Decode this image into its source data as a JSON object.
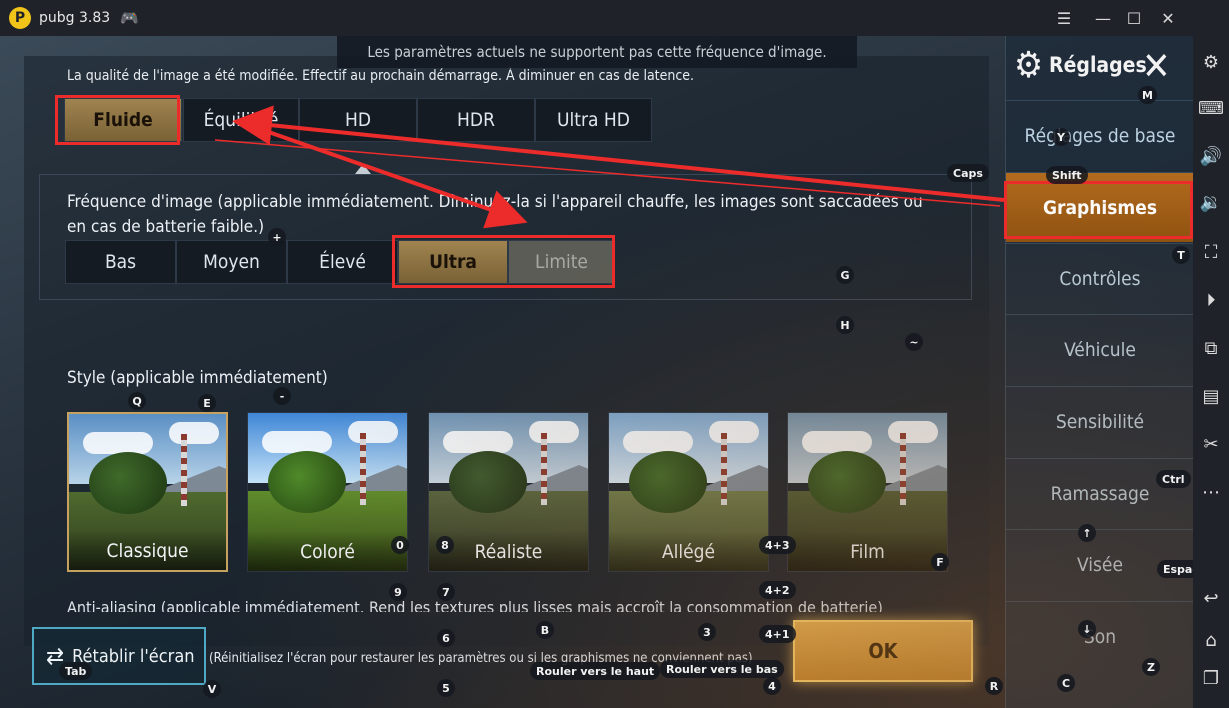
{
  "window": {
    "app_name": "pubg 3.83"
  },
  "toast": "Les paramètres actuels ne supportent pas cette fréquence d'image.",
  "graphics": {
    "note": "La qualité de l'image a été modifiée. Effectif au prochain démarrage. À diminuer en cas de latence.",
    "options": [
      "Fluide",
      "Équilibré",
      "HD",
      "HDR",
      "Ultra HD"
    ],
    "selected": "Fluide"
  },
  "fps": {
    "title": "Fréquence d'image (applicable immédiatement. Diminuez-la si l'appareil chauffe, les images sont saccadées ou en cas de batterie faible.)",
    "options": [
      "Bas",
      "Moyen",
      "Élevé",
      "Ultra",
      "Limite"
    ],
    "selected": "Ultra"
  },
  "style": {
    "title": "Style (applicable immédiatement)",
    "cards": [
      "Classique",
      "Coloré",
      "Réaliste",
      "Allégé",
      "Film"
    ],
    "selected": "Classique"
  },
  "antialias_text": "Anti-aliasing (applicable immédiatement. Rend les textures plus lisses mais accroît la consommation de batterie)",
  "reset": {
    "label": "Rétablir l'écran",
    "note": "(Réinitialisez l'écran pour restaurer les paramètres ou si les graphismes ne conviennent pas)"
  },
  "ok_label": "OK",
  "nav": {
    "title": "Réglages",
    "items": [
      "Réglages de base",
      "Graphismes",
      "Contrôles",
      "Véhicule",
      "Sensibilité",
      "Ramassage",
      "Visée",
      "Son"
    ],
    "active": "Graphismes"
  },
  "keymap": {
    "m": "M",
    "y": "Y",
    "caps": "Caps",
    "shift": "Shift",
    "t": "T",
    "plus": "+",
    "g": "G",
    "h": "H",
    "tilde": "~",
    "q": "Q",
    "e": "E",
    "minus": "-",
    "zero": "0",
    "eight": "8",
    "four_three": "4+3",
    "f": "F",
    "ctrl": "Ctrl",
    "nine": "9",
    "seven": "7",
    "four_two": "4+2",
    "espace": "Espac",
    "up": "↑",
    "b": "B",
    "three": "3",
    "four_one": "4+1",
    "six": "6",
    "down": "↓",
    "scroll_up": "Rouler vers le haut",
    "scroll_down": "Rouler vers le bas",
    "tab": "Tab",
    "v": "V",
    "five": "5",
    "four": "4",
    "r": "R",
    "z": "Z",
    "c": "C"
  }
}
